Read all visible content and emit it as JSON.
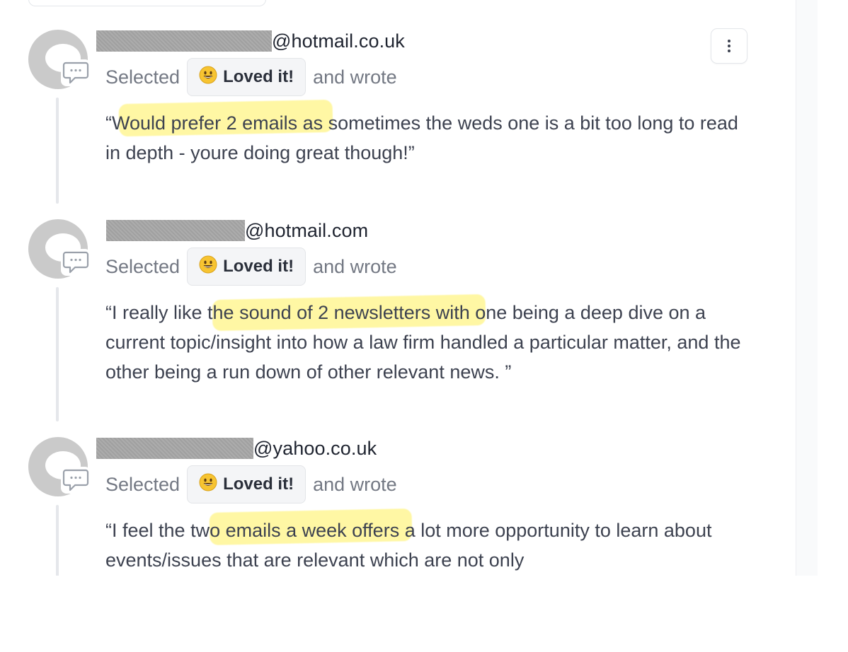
{
  "responses": [
    {
      "email_domain": "@hotmail.co.uk",
      "selected_label": "Selected",
      "reaction_label": "Loved it!",
      "wrote_label": "and wrote",
      "comment": "“Would prefer 2 emails as sometimes the weds one is a bit too long to read in depth - youre doing great though!”",
      "highlight": "Would prefer 2 emails"
    },
    {
      "email_domain": "@hotmail.com",
      "selected_label": "Selected",
      "reaction_label": "Loved it!",
      "wrote_label": "and wrote",
      "comment": "“I really like the sound of 2 newsletters with one being a deep dive on a current topic/insight into how a law firm handled a particular matter, and the other being a run down of other relevant news. ”",
      "highlight": "the sound of 2 newsletters"
    },
    {
      "email_domain": "@yahoo.co.uk",
      "selected_label": "Selected",
      "reaction_label": "Loved it!",
      "wrote_label": "and wrote",
      "comment": "“I feel the two emails a week offers a lot more opportunity to learn about events/issues that are relevant which are not only",
      "highlight": "two emails a week"
    }
  ],
  "icons": {
    "reaction": "grinning-face-icon",
    "comment": "comment-bubble-icon",
    "menu": "more-vertical-icon",
    "avatar": "default-avatar-icon"
  },
  "colors": {
    "highlight": "#fff05a",
    "text": "#3d4250",
    "muted": "#737883",
    "redaction": "#a7a7a7"
  }
}
